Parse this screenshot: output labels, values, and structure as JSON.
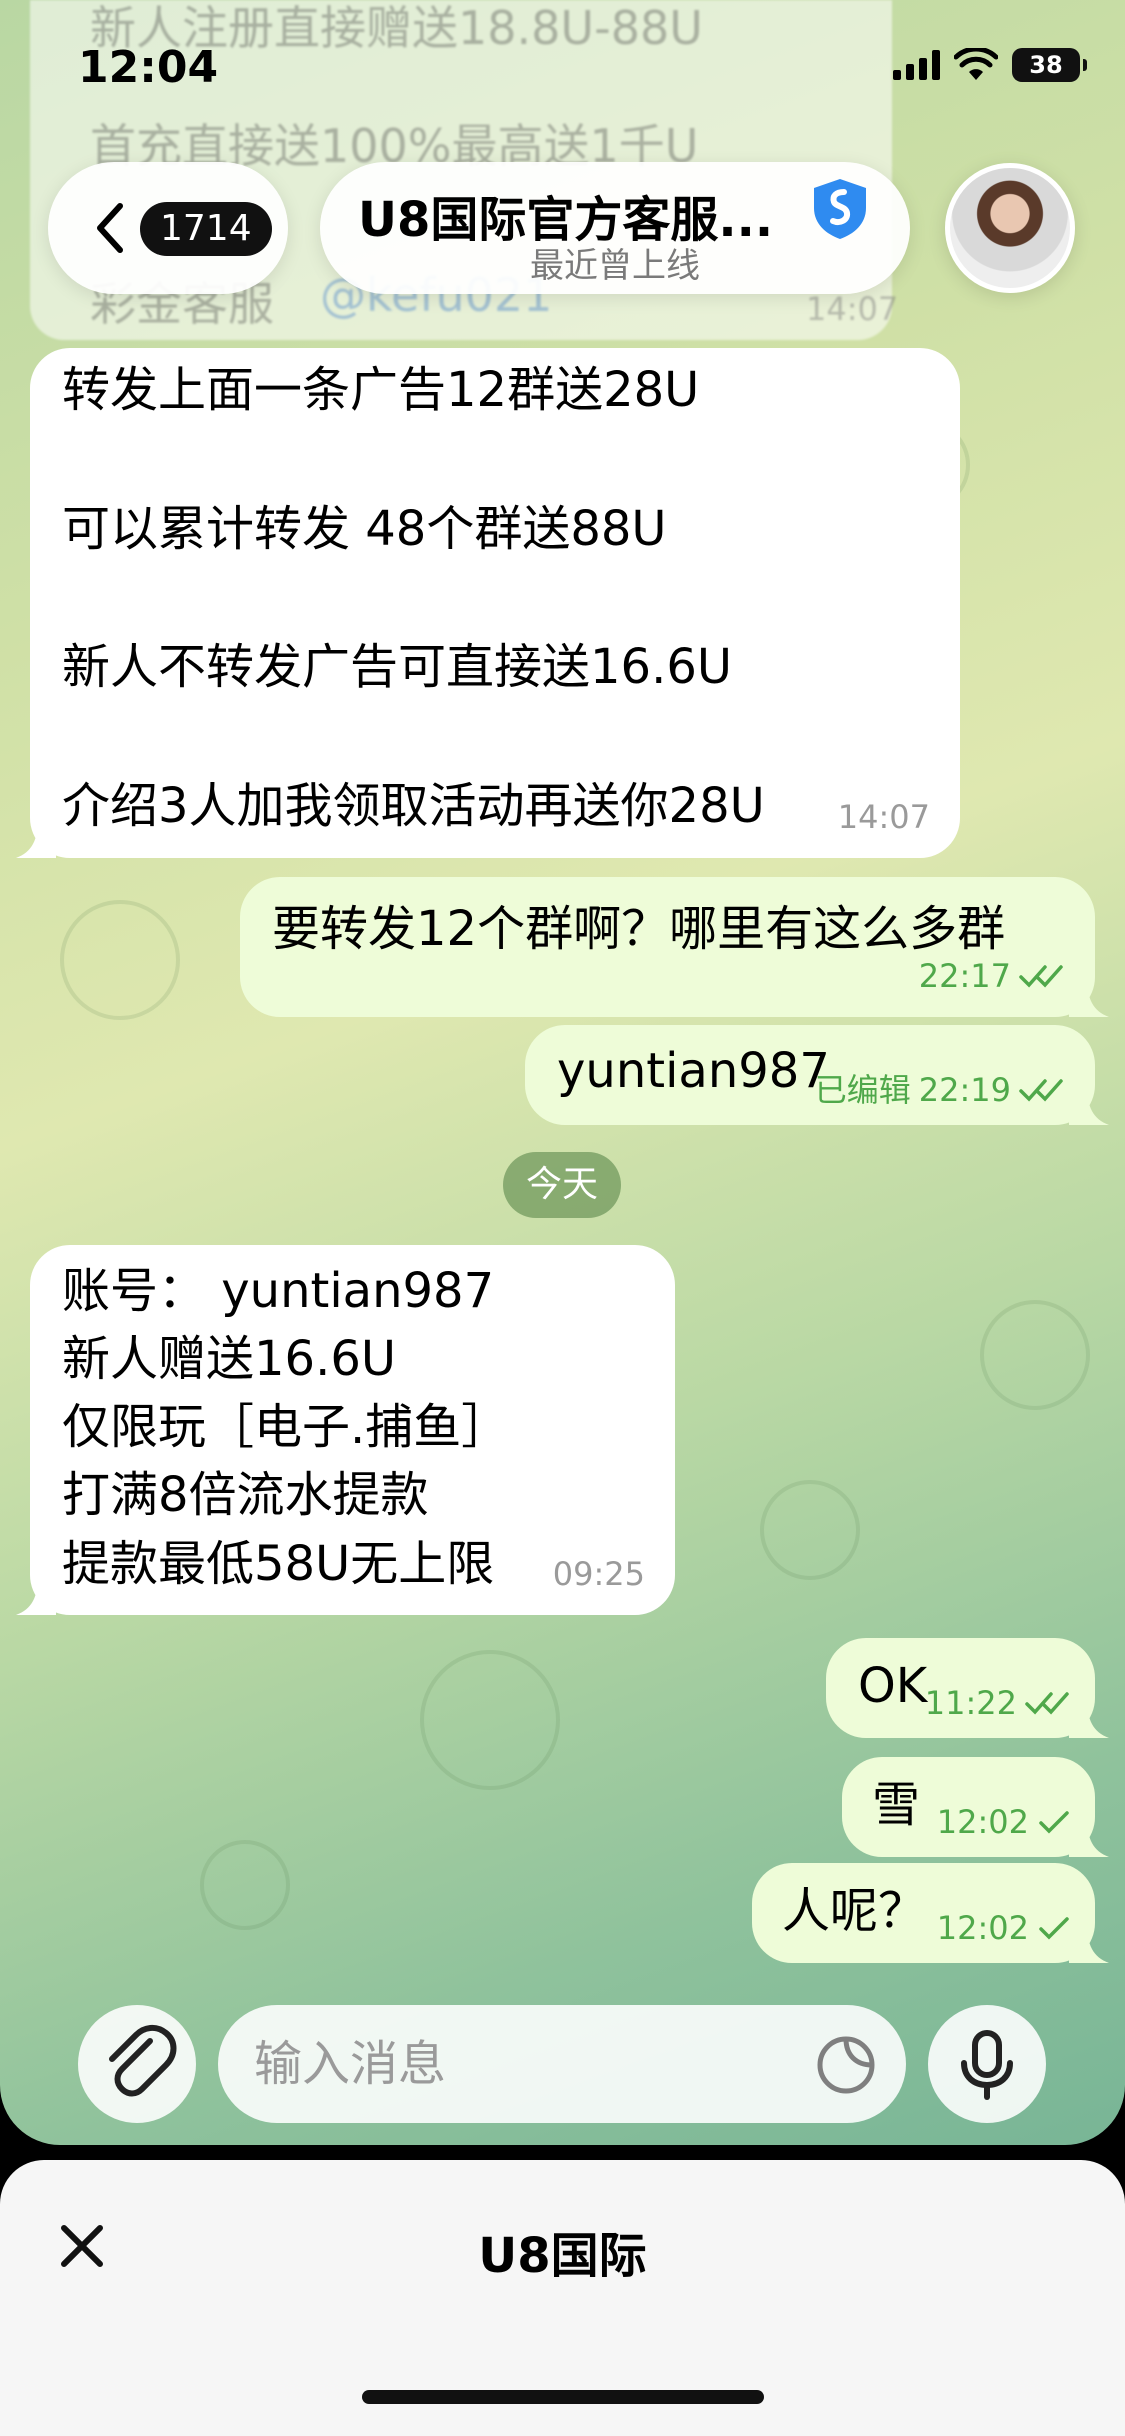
{
  "status_bar": {
    "time": "12:04",
    "battery": "38"
  },
  "faded_message": {
    "line1": "新人注册直接赠送18.8U-88U",
    "line2": "首充直接送100%最高送1千U",
    "line3_label": "彩金客服",
    "line3_handle": "@kefu021",
    "time": "14:07"
  },
  "header": {
    "unread_count": "1714",
    "title": "U8国际官方客服...",
    "subtitle": "最近曾上线"
  },
  "messages": [
    {
      "direction": "incoming",
      "lines": [
        "转发上面一条广告12群送28U",
        "",
        "可以累计转发 48个群送88U",
        "",
        "新人不转发广告可直接送16.6U",
        "",
        "介绍3人加我领取活动再送你28U"
      ],
      "time": "14:07"
    },
    {
      "direction": "outgoing",
      "text": "要转发12个群啊？哪里有这么多群",
      "time": "22:17",
      "status": "read"
    },
    {
      "direction": "outgoing",
      "text": "yuntian987",
      "edited_label": "已编辑",
      "time": "22:19",
      "status": "read"
    },
    {
      "direction": "outgoing",
      "text": "OK",
      "time": "11:22",
      "status": "read"
    },
    {
      "direction": "outgoing",
      "text": "雪",
      "time": "12:02",
      "status": "sent"
    },
    {
      "direction": "outgoing",
      "text": "人呢？",
      "time": "12:02",
      "status": "sent"
    }
  ],
  "date_separator": "今天",
  "account_message": {
    "lines": [
      "账号： yuntian987",
      "新人赠送16.6U",
      "仅限玩［电子.捕鱼］",
      "打满8倍流水提款",
      "提款最低58U无上限"
    ],
    "time": "09:25"
  },
  "composer": {
    "placeholder": "输入消息"
  },
  "bottom_sheet": {
    "title": "U8国际"
  },
  "colors": {
    "outgoing_bubble": "#eefcd8",
    "incoming_bubble": "#ffffff",
    "read_ticks": "#4fa84a",
    "verified_badge": "#2f8bf0"
  },
  "icons": {
    "back": "chevron-left-icon",
    "verified": "verified-shield-icon",
    "attach": "paperclip-icon",
    "sticker": "sticker-icon",
    "mic": "microphone-icon",
    "close": "close-icon"
  }
}
